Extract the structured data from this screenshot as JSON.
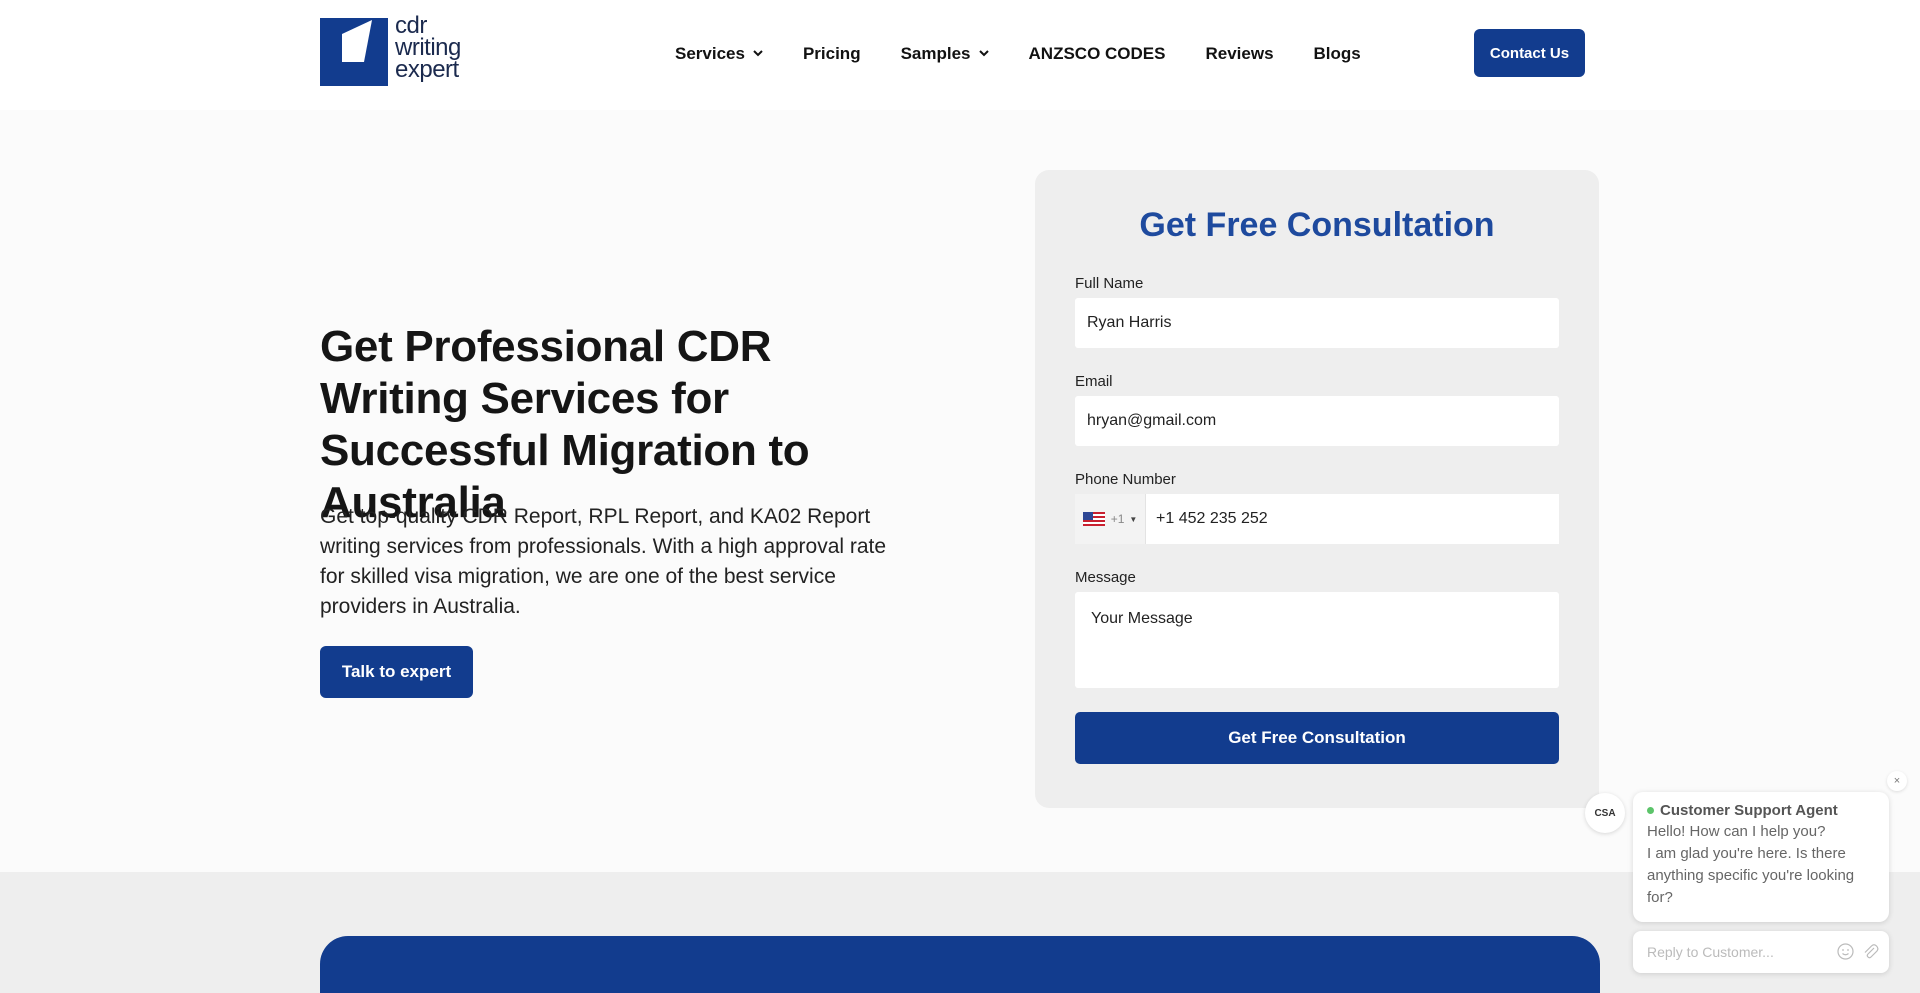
{
  "header": {
    "logo_text": [
      "cdr",
      "writing",
      "expert"
    ],
    "nav": [
      {
        "label": "Services",
        "has_dropdown": true
      },
      {
        "label": "Pricing",
        "has_dropdown": false
      },
      {
        "label": "Samples",
        "has_dropdown": true
      },
      {
        "label": "ANZSCO CODES",
        "has_dropdown": false
      },
      {
        "label": "Reviews",
        "has_dropdown": false
      },
      {
        "label": "Blogs",
        "has_dropdown": false
      }
    ],
    "contact_label": "Contact Us"
  },
  "hero": {
    "title": "Get Professional CDR Writing Services for Successful Migration to Australia",
    "description": "Get top-quality CDR Report, RPL Report, and KA02 Report writing services from professionals. With a high approval rate for skilled visa migration, we are one of the best service providers in Australia.",
    "cta_label": "Talk to expert"
  },
  "form": {
    "title": "Get Free Consultation",
    "full_name_label": "Full Name",
    "full_name_value": "Ryan Harris",
    "email_label": "Email",
    "email_value": "hryan@gmail.com",
    "phone_label": "Phone Number",
    "phone_country_code": "+1",
    "phone_value": "+1 452 235 252",
    "message_label": "Message",
    "message_placeholder": "Your Message",
    "submit_label": "Get Free Consultation"
  },
  "chat": {
    "avatar_initials": "CSA",
    "agent_name": "Customer Support Agent",
    "message": "Hello! How can I help you?\nI am  glad you're here. Is there anything specific you're looking for?",
    "reply_placeholder": "Reply to Customer...",
    "close_icon": "×"
  },
  "colors": {
    "brand_blue": "#123c8e",
    "title_blue": "#1e4a9e",
    "online_green": "#5cc46a"
  }
}
